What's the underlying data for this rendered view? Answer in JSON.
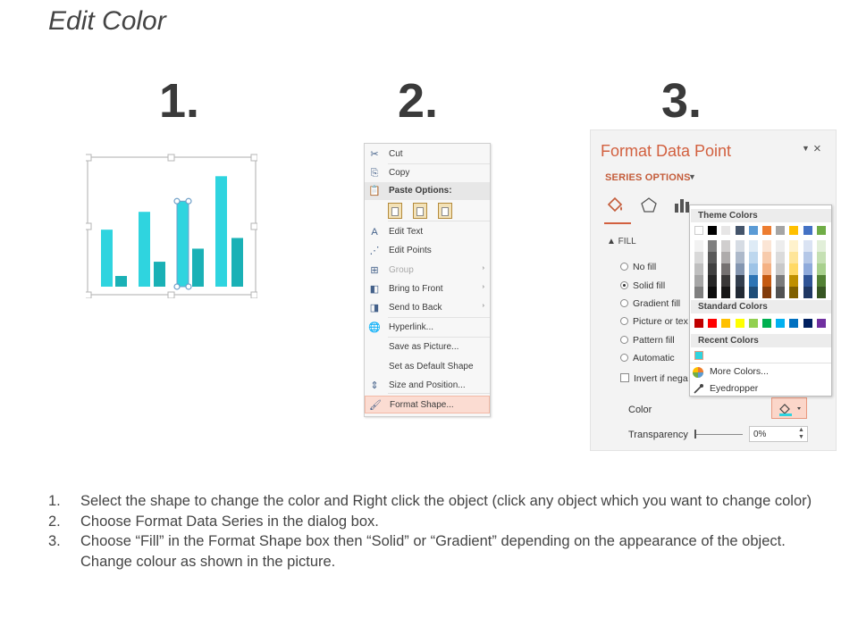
{
  "page": {
    "title": "Edit Color"
  },
  "steps": [
    "1.",
    "2.",
    "3."
  ],
  "step1": {
    "bars_a": [
      0.48,
      0.63,
      0.72,
      0.93
    ],
    "bars_b": [
      0.09,
      0.21,
      0.32,
      0.41
    ],
    "selected_bar_index": 2,
    "colors": {
      "light": "#2fd4df",
      "dark": "#1ab1b6",
      "handle": "#6fa0c8",
      "frame": "#c9c9c9"
    }
  },
  "context_menu": {
    "items": [
      {
        "label": "Cut",
        "icon": "scissors-icon",
        "glyph": "✂",
        "type": "item"
      },
      {
        "label": "Copy",
        "icon": "copy-icon",
        "glyph": "⎘",
        "type": "item"
      },
      {
        "label": "Paste Options:",
        "icon": "paste-icon",
        "glyph": "📋",
        "type": "header"
      },
      {
        "label": "Edit Text",
        "icon": "edit-text-icon",
        "glyph": "A",
        "type": "item"
      },
      {
        "label": "Edit Points",
        "icon": "edit-points-icon",
        "glyph": "⋰",
        "type": "item"
      },
      {
        "label": "Group",
        "icon": "group-icon",
        "glyph": "⊞",
        "type": "disabled",
        "submenu": true
      },
      {
        "label": "Bring to Front",
        "icon": "bring-front-icon",
        "glyph": "◧",
        "type": "item",
        "submenu": true
      },
      {
        "label": "Send to Back",
        "icon": "send-back-icon",
        "glyph": "◨",
        "type": "item",
        "submenu": true
      },
      {
        "label": "Hyperlink...",
        "icon": "hyperlink-icon",
        "glyph": "🌐",
        "type": "item"
      },
      {
        "label": "Save as Picture...",
        "icon": "",
        "glyph": "",
        "type": "item"
      },
      {
        "label": "Set as Default Shape",
        "icon": "",
        "glyph": "",
        "type": "item"
      },
      {
        "label": "Size and Position...",
        "icon": "size-position-icon",
        "glyph": "⇕",
        "type": "item"
      },
      {
        "label": "Format Shape...",
        "icon": "format-shape-icon",
        "glyph": "🖌",
        "type": "highlight"
      }
    ],
    "submenu_arrow": "›"
  },
  "format_panel": {
    "title": "Format Data Point",
    "close": "×",
    "dropdown": "▼",
    "series_options": "SERIES OPTIONS",
    "series_caret": "▼",
    "fill_header": "▲ FILL",
    "options": [
      {
        "label": "No fill",
        "type": "radio",
        "on": false
      },
      {
        "label": "Solid fill",
        "type": "radio",
        "on": true
      },
      {
        "label": "Gradient fill",
        "type": "radio",
        "on": false
      },
      {
        "label": "Picture or tex",
        "type": "radio",
        "on": false
      },
      {
        "label": "Pattern fill",
        "type": "radio",
        "on": false
      },
      {
        "label": "Automatic",
        "type": "radio",
        "on": false
      },
      {
        "label": "Invert if nega",
        "type": "check",
        "on": false
      }
    ],
    "color_label": "Color",
    "transparency_label": "Transparency",
    "transparency_value": "0%",
    "accent": "#d2603f"
  },
  "color_popup": {
    "theme_header": "Theme Colors",
    "standard_header": "Standard Colors",
    "recent_header": "Recent Colors",
    "more_colors": "More Colors...",
    "eyedropper": "Eyedropper",
    "theme_colors": [
      "#ffffff",
      "#000000",
      "#e7e6e6",
      "#44546a",
      "#5b9bd5",
      "#ed7d31",
      "#a5a5a5",
      "#ffc000",
      "#4472c4",
      "#70ad47"
    ],
    "theme_shades": [
      [
        "#f2f2f2",
        "#d9d9d9",
        "#bfbfbf",
        "#a6a6a6",
        "#808080"
      ],
      [
        "#7f7f7f",
        "#595959",
        "#404040",
        "#262626",
        "#0d0d0d"
      ],
      [
        "#d0cece",
        "#aeabab",
        "#757171",
        "#3a3838",
        "#171616"
      ],
      [
        "#d6dce4",
        "#adb9ca",
        "#8496b0",
        "#333f4f",
        "#222a35"
      ],
      [
        "#deebf6",
        "#bdd7ee",
        "#9dc3e6",
        "#2e75b5",
        "#1f4e79"
      ],
      [
        "#fbe5d5",
        "#f7cbac",
        "#f4b183",
        "#c55a11",
        "#833c0b"
      ],
      [
        "#ededed",
        "#dbdbdb",
        "#c9c9c9",
        "#7b7b7b",
        "#525252"
      ],
      [
        "#fff2cc",
        "#fee599",
        "#ffd965",
        "#bf9000",
        "#7f6000"
      ],
      [
        "#dae3f3",
        "#b4c7e7",
        "#8eaadb",
        "#2f5496",
        "#1f3864"
      ],
      [
        "#e2efd9",
        "#c5e0b3",
        "#a8d08d",
        "#538135",
        "#375623"
      ]
    ],
    "standard_colors": [
      "#c00000",
      "#ff0000",
      "#ffc000",
      "#ffff00",
      "#92d050",
      "#00b050",
      "#00b0f0",
      "#0070c0",
      "#002060",
      "#7030a0"
    ],
    "recent_colors": [
      "#2fd4df"
    ]
  },
  "instructions": [
    {
      "n": "1.",
      "text": "Select the shape to change the color and Right click the object (click any object which you want to change color)"
    },
    {
      "n": "2.",
      "text": "Choose Format Data Series in the dialog box."
    },
    {
      "n": "3.",
      "text": "Choose “Fill” in the Format Shape box then “Solid” or “Gradient” depending on the appearance of the object. Change colour as shown in the picture."
    }
  ]
}
